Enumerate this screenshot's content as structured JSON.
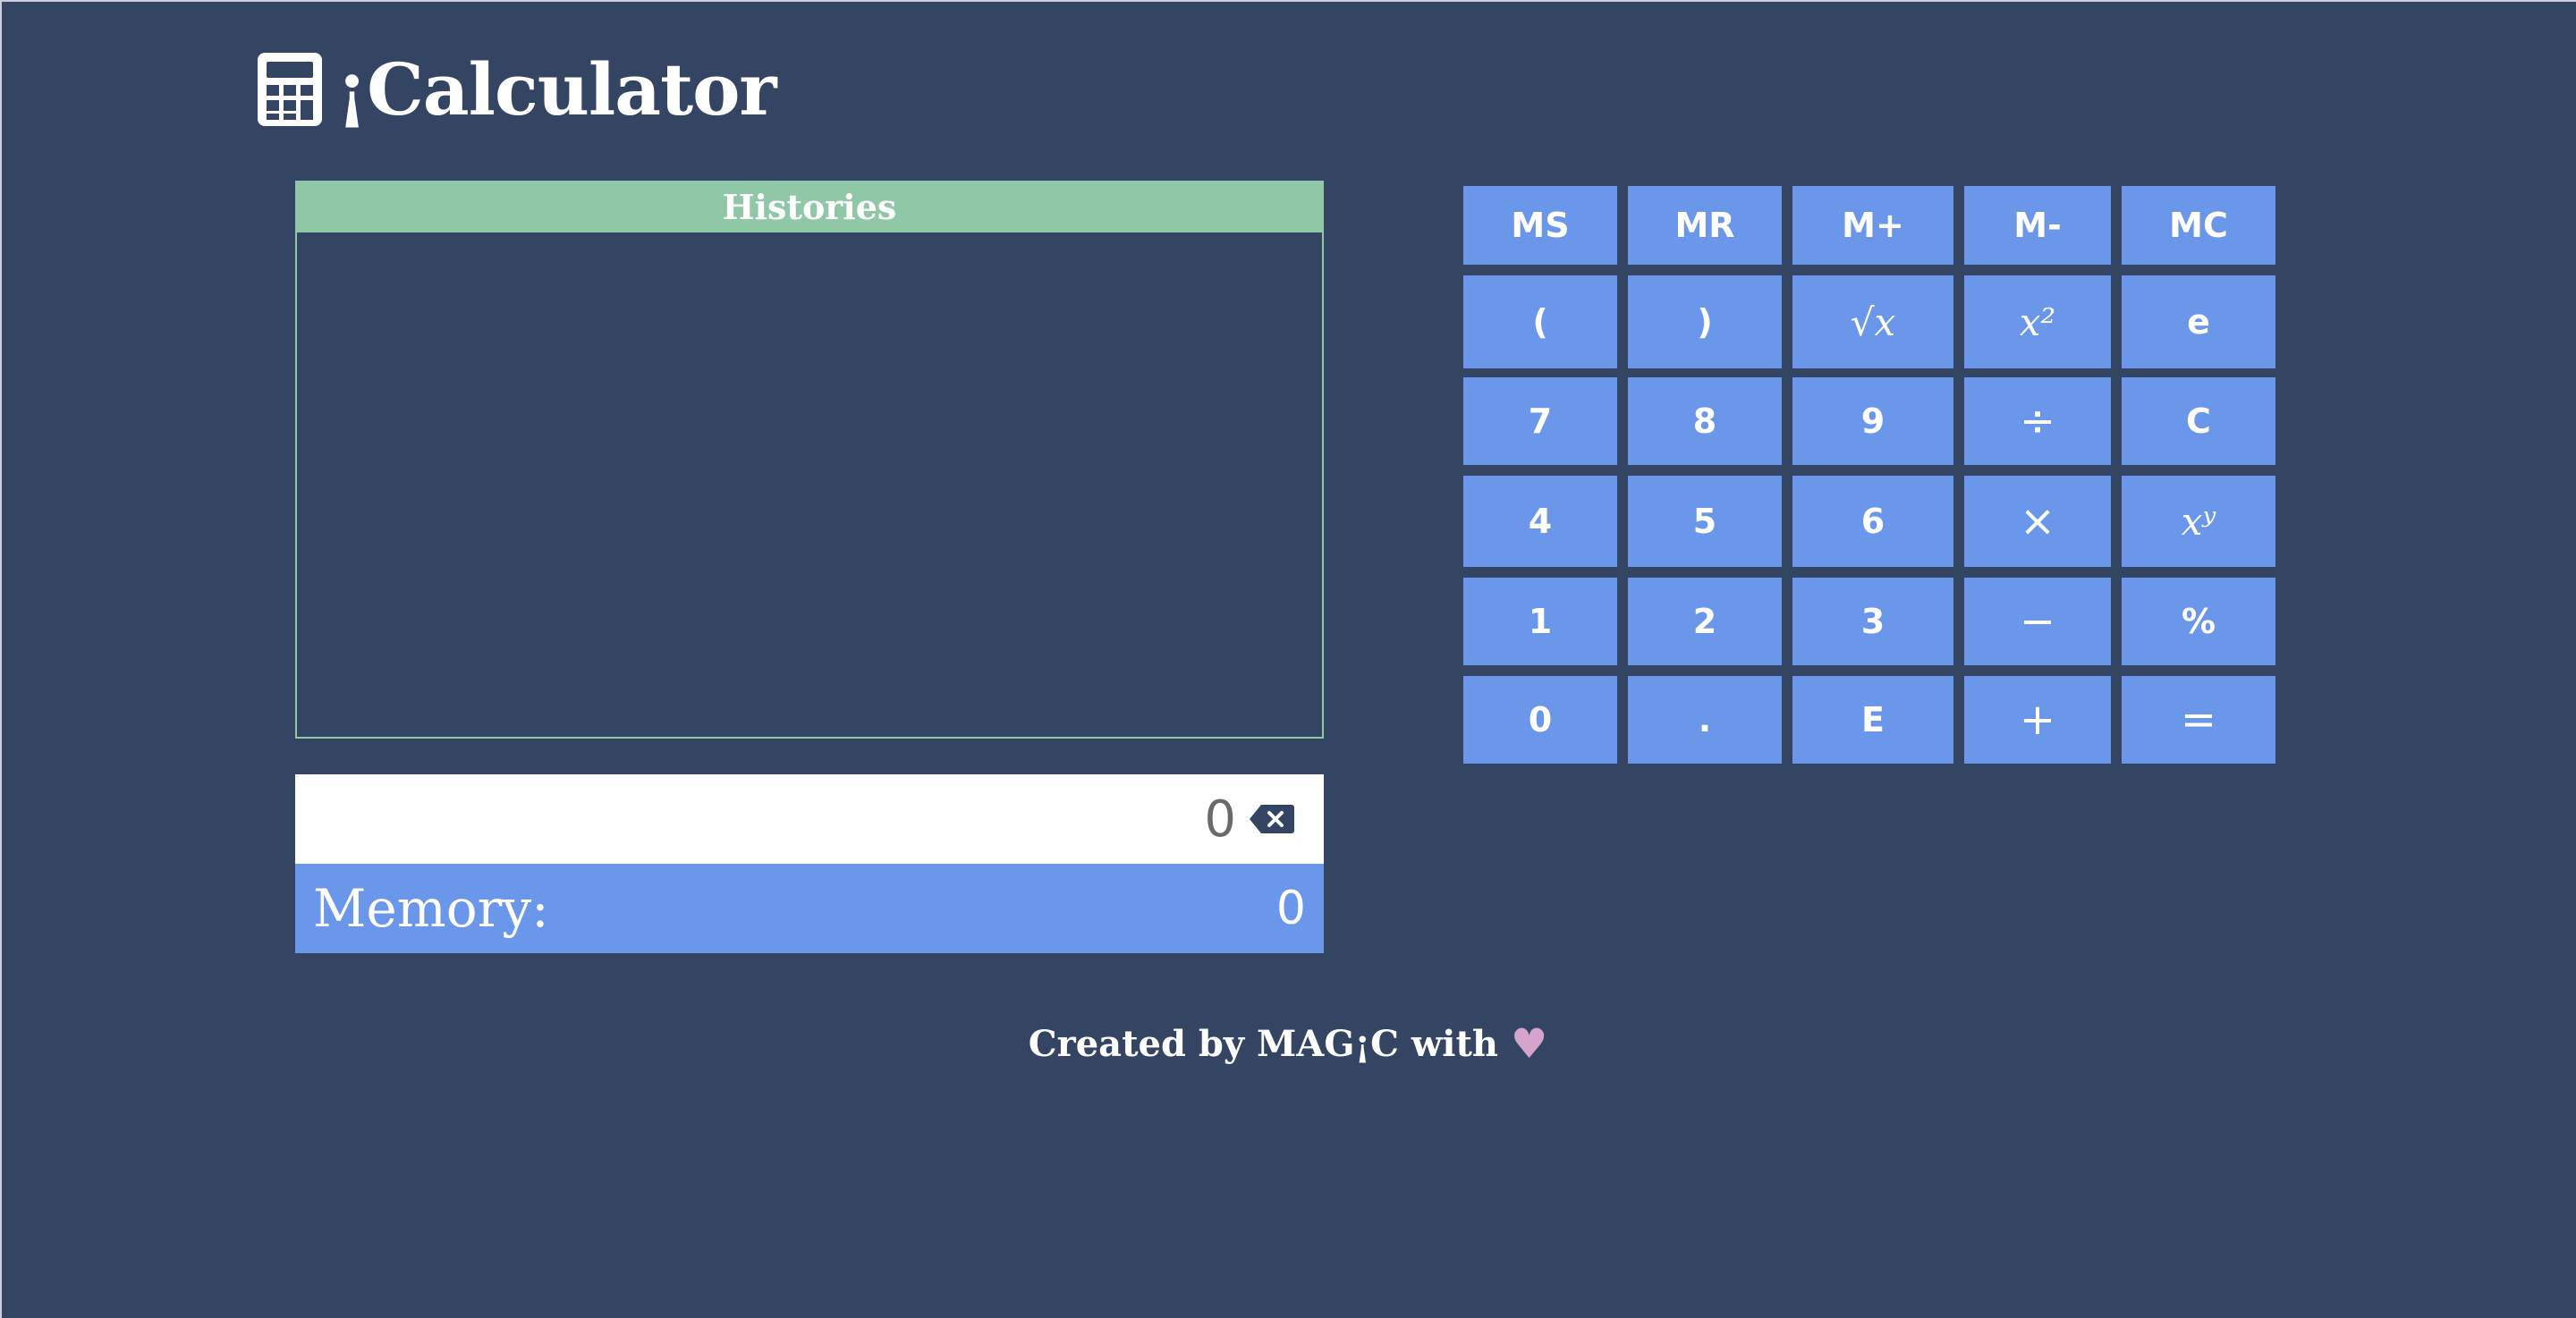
{
  "app": {
    "title": "¡Calculator",
    "icon": "calculator-icon"
  },
  "histories": {
    "title": "Histories",
    "entries": []
  },
  "display": {
    "value": "0",
    "backspace_icon": "backspace-icon"
  },
  "memory": {
    "label": "Memory:",
    "value": "0"
  },
  "keypad": {
    "rows": [
      [
        "MS",
        "MR",
        "M+",
        "M-",
        "MC"
      ],
      [
        "(",
        ")",
        "√x",
        "x²",
        "e"
      ],
      [
        "7",
        "8",
        "9",
        "÷",
        "C"
      ],
      [
        "4",
        "5",
        "6",
        "×",
        "xʸ"
      ],
      [
        "1",
        "2",
        "3",
        "−",
        "%"
      ],
      [
        "0",
        ".",
        "E",
        "+",
        "="
      ]
    ]
  },
  "footer": {
    "text": "Created by MAG¡C with",
    "heart_icon": "heart-icon"
  },
  "colors": {
    "background": "#344463",
    "accent": "#6b97ea",
    "histories": "#8fc7a7",
    "heart": "#d4a4cc"
  }
}
